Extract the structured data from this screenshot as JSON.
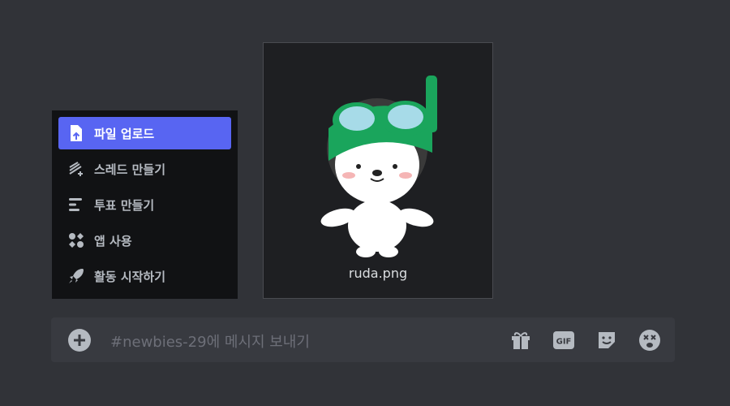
{
  "attachment": {
    "filename": "ruda.png"
  },
  "menu": {
    "items": [
      {
        "label": "파일 업로드",
        "icon": "file-upload-icon",
        "active": true
      },
      {
        "label": "스레드 만들기",
        "icon": "thread-icon",
        "active": false
      },
      {
        "label": "투표 만들기",
        "icon": "poll-icon",
        "active": false
      },
      {
        "label": "앱 사용",
        "icon": "apps-icon",
        "active": false
      },
      {
        "label": "활동 시작하기",
        "icon": "rocket-icon",
        "active": false
      }
    ]
  },
  "composer": {
    "placeholder": "#newbies-29에 메시지 보내기",
    "tools": [
      "gift-icon",
      "gif-icon",
      "sticker-icon",
      "emoji-icon"
    ]
  },
  "colors": {
    "accent": "#5865f2",
    "background": "#313338",
    "menu_bg": "#111214",
    "composer_bg": "#383a40"
  }
}
